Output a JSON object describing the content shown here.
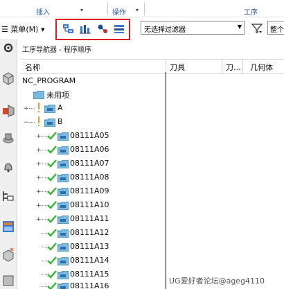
{
  "ribbon": {
    "group_insert": "插入",
    "group_operation": "操作",
    "group_operation2": "工序"
  },
  "toolbar": {
    "menu_label": "菜单(M)",
    "menu_arrow": "▾",
    "filter_value": "无选择过滤器",
    "whole_value": "整个"
  },
  "navigator": {
    "title": "工序导航器 - 程序顺序",
    "columns": [
      "名称",
      "刀具",
      "刀...",
      "几何体"
    ],
    "tree": [
      {
        "label": "NC_PROGRAM",
        "level": 0,
        "type": "root"
      },
      {
        "label": "未用项",
        "level": 1,
        "type": "folder"
      },
      {
        "label": "A",
        "level": 1,
        "type": "folder",
        "expander": "+",
        "warn": true
      },
      {
        "label": "B",
        "level": 1,
        "type": "folder",
        "expander": "−",
        "warn": true
      },
      {
        "label": "08111A05",
        "level": 2,
        "type": "op",
        "expander": "+"
      },
      {
        "label": "08111A06",
        "level": 2,
        "type": "op",
        "expander": "+"
      },
      {
        "label": "08111A07",
        "level": 2,
        "type": "op",
        "expander": "+"
      },
      {
        "label": "08111A08",
        "level": 2,
        "type": "op",
        "expander": "+"
      },
      {
        "label": "08111A09",
        "level": 2,
        "type": "op",
        "expander": "+"
      },
      {
        "label": "08111A10",
        "level": 2,
        "type": "op",
        "expander": "+"
      },
      {
        "label": "08111A11",
        "level": 2,
        "type": "op",
        "expander": "+"
      },
      {
        "label": "08111A12",
        "level": 2,
        "type": "op"
      },
      {
        "label": "08111A13",
        "level": 2,
        "type": "op"
      },
      {
        "label": "08111A14",
        "level": 2,
        "type": "op"
      },
      {
        "label": "08111A15",
        "level": 2,
        "type": "op"
      },
      {
        "label": "08111A16",
        "level": 2,
        "type": "op"
      }
    ]
  },
  "watermark": "UG爱好者论坛@ageg4110",
  "colors": {
    "highlight": "#e02020",
    "check": "#2eb82e",
    "folder": "#7ab9e0",
    "warn": "#e8a020"
  }
}
